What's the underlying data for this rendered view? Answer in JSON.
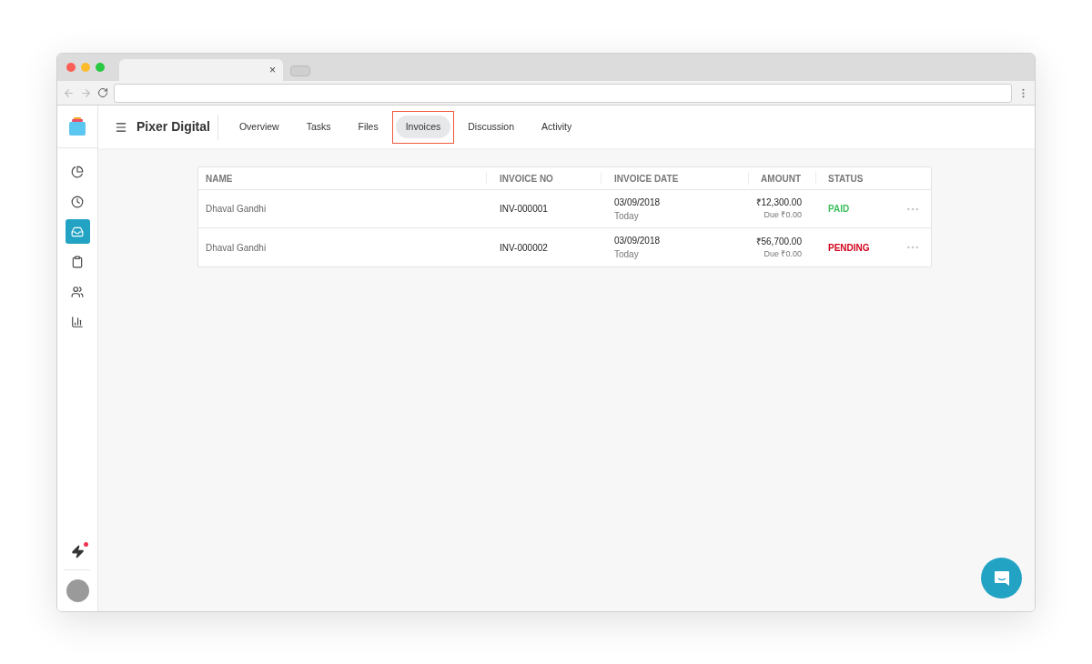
{
  "browser": {
    "tab_close": "×"
  },
  "header": {
    "title": "Pixer Digital"
  },
  "sidebar": {
    "items": [
      {
        "selected": false
      },
      {
        "selected": false
      },
      {
        "selected": true
      },
      {
        "selected": false
      },
      {
        "selected": false
      },
      {
        "selected": false
      }
    ],
    "notification_dot": true
  },
  "tabs": [
    {
      "label": "Overview",
      "selected": false
    },
    {
      "label": "Tasks",
      "selected": false
    },
    {
      "label": "Files",
      "selected": false
    },
    {
      "label": "Invoices",
      "selected": true
    },
    {
      "label": "Discussion",
      "selected": false
    },
    {
      "label": "Activity",
      "selected": false
    }
  ],
  "table": {
    "columns": [
      "NAME",
      "INVOICE NO",
      "INVOICE DATE",
      "AMOUNT",
      "STATUS"
    ],
    "rows": [
      {
        "name": "Dhaval Gandhi",
        "invoice_no": "INV-000001",
        "date": "03/09/2018",
        "date_note": "Today",
        "amount": "₹12,300.00",
        "due": "Due ₹0.00",
        "status": {
          "kind": "paid",
          "label": "PAID"
        }
      },
      {
        "name": "Dhaval Gandhi",
        "invoice_no": "INV-000002",
        "date": "03/09/2018",
        "date_note": "Today",
        "amount": "₹56,700.00",
        "due": "Due ₹0.00",
        "status": {
          "kind": "pending",
          "label": "PENDING"
        }
      }
    ]
  }
}
